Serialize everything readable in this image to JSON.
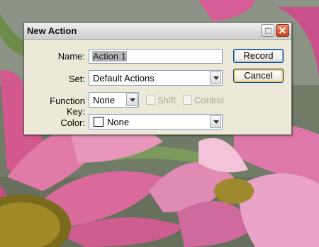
{
  "dialog": {
    "title": "New Action",
    "close_glyph": "✕",
    "fields": {
      "name_label": "Name:",
      "name_value": "Action 1",
      "set_label": "Set:",
      "set_value": "Default Actions",
      "function_key_label": "Function Key:",
      "function_key_value": "None",
      "shift_label": "Shift",
      "control_label": "Control",
      "color_label": "Color:",
      "color_value": "None"
    },
    "buttons": {
      "record": "Record",
      "cancel": "Cancel"
    }
  },
  "icons": {
    "restore": "restore-icon",
    "close": "close-icon",
    "dropdown": "chevron-down-icon"
  },
  "colors": {
    "dialog_bg": "#ece9d8",
    "close_button": "#c5431f",
    "field_border": "#7f9db9",
    "button_border": "#003c74"
  }
}
